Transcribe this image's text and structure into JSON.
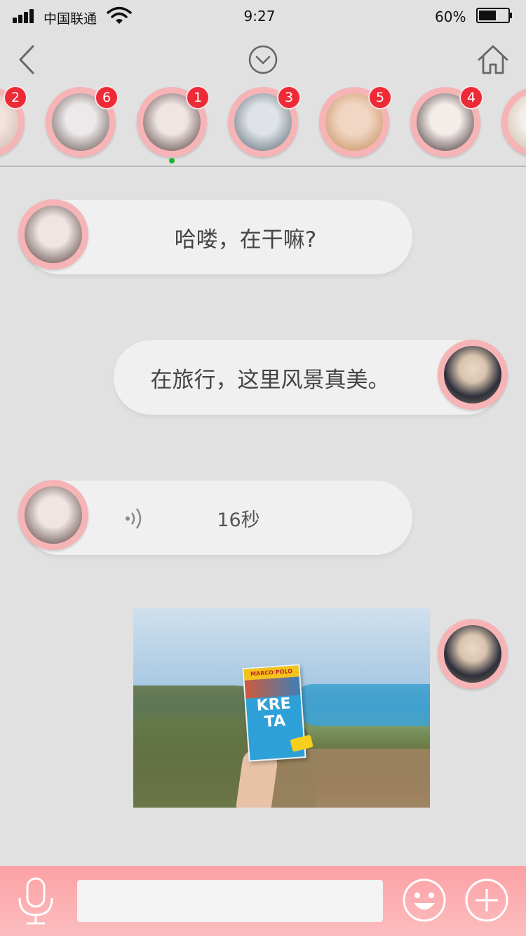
{
  "status_bar": {
    "carrier": "中国联通",
    "time": "9:27",
    "battery_percent": "60%",
    "battery_level": 0.6
  },
  "nav": {
    "back_icon": "chevron-left-icon",
    "center_icon": "chevron-down-circle-icon",
    "home_icon": "home-icon"
  },
  "contacts": [
    {
      "badge": "2",
      "avatar_colors": [
        "#f3e3e0",
        "#c9b6a8"
      ]
    },
    {
      "badge": "6",
      "avatar_colors": [
        "#ece9ea",
        "#5c4a44"
      ]
    },
    {
      "badge": "1",
      "avatar_colors": [
        "#efe6e4",
        "#4a3230"
      ],
      "active": true
    },
    {
      "badge": "3",
      "avatar_colors": [
        "#dfe3e7",
        "#55636f"
      ]
    },
    {
      "badge": "5",
      "avatar_colors": [
        "#f1d7c3",
        "#c48857"
      ]
    },
    {
      "badge": "4",
      "avatar_colors": [
        "#f3ece9",
        "#332425"
      ]
    },
    {
      "badge": "",
      "avatar_colors": [
        "#f3efe9",
        "#cdb9a6"
      ]
    }
  ],
  "messages": [
    {
      "from": "other",
      "type": "text",
      "text": "哈喽，在干嘛?"
    },
    {
      "from": "me",
      "type": "text",
      "text": "在旅行，这里风景真美。"
    },
    {
      "from": "other",
      "type": "voice",
      "duration": "16秒"
    },
    {
      "from": "me",
      "type": "image",
      "book_brand": "MARCO POLO",
      "book_title": "KRE TA"
    }
  ],
  "bottom_bar": {
    "mic_icon": "microphone-icon",
    "input_placeholder": "",
    "emoji_icon": "emoji-icon",
    "add_icon": "plus-circle-icon"
  },
  "colors": {
    "accent_pink": "#f6b4b6",
    "badge_red": "#ee2a36",
    "online_green": "#1fb532",
    "bubble": "#f0f0f0"
  }
}
